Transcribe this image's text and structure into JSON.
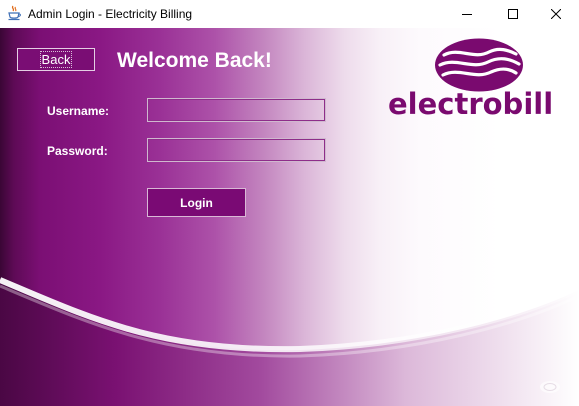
{
  "window": {
    "title": "Admin Login - Electricity Billing",
    "icon": "java-cup-icon",
    "controls": {
      "minimize": "minimize-icon",
      "maximize": "maximize-icon",
      "close": "close-icon"
    }
  },
  "header": {
    "back_label": "Back",
    "welcome_text": "Welcome Back!"
  },
  "form": {
    "username_label": "Username:",
    "username_value": "",
    "password_label": "Password:",
    "password_value": "",
    "login_label": "Login"
  },
  "logo": {
    "text": "electrobill",
    "color": "#7a0a6f"
  },
  "colors": {
    "accent": "#7a0a74",
    "dark": "#3a0635"
  }
}
